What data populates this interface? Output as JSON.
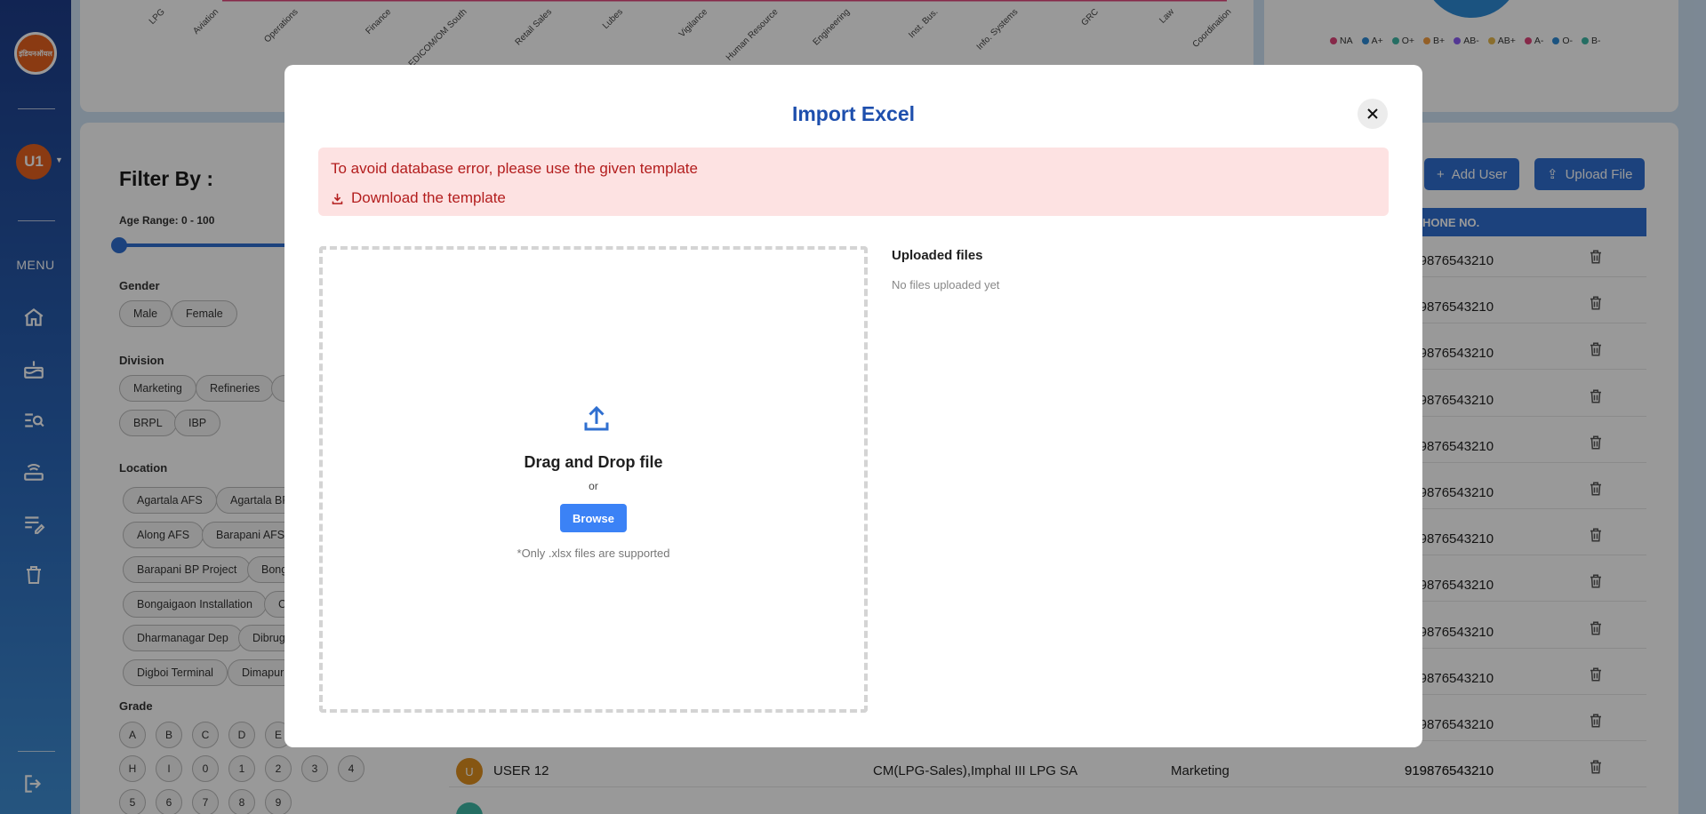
{
  "sidebar": {
    "logo_text": "इंडियनऑयल",
    "user_initials": "U1",
    "menu_label": "MENU",
    "icons": [
      "home-icon",
      "cake-icon",
      "search-list-icon",
      "router-icon",
      "edit-list-icon",
      "trash-icon"
    ],
    "logout_icon": "logout-icon"
  },
  "chart_bg": {
    "x_labels": [
      "LPG",
      "Aviation",
      "Operations",
      "Finance",
      "EDICOM/OM South",
      "Retail Sales",
      "Lubes",
      "Vigilance",
      "Human Resource",
      "Engineering",
      "Inst. Bus.",
      "Info. Systems",
      "GRC",
      "Law",
      "Coordination"
    ],
    "legend": [
      {
        "label": "NA",
        "color": "#e0457b"
      },
      {
        "label": "A+",
        "color": "#2e8ad6"
      },
      {
        "label": "O+",
        "color": "#3fb8a6"
      },
      {
        "label": "B+",
        "color": "#f59e42"
      },
      {
        "label": "AB-",
        "color": "#8b5cf6"
      },
      {
        "label": "AB+",
        "color": "#e7b84b"
      },
      {
        "label": "A-",
        "color": "#e0457b"
      },
      {
        "label": "O-",
        "color": "#2e8ad6"
      },
      {
        "label": "B-",
        "color": "#3fb8a6"
      }
    ]
  },
  "filter": {
    "title": "Filter By :",
    "age_label": "Age Range: 0 - 100",
    "gender_label": "Gender",
    "gender": [
      "Male",
      "Female"
    ],
    "division_label": "Division",
    "division": [
      "Marketing",
      "Refineries",
      "BRPL",
      "IBP"
    ],
    "location_label": "Location",
    "location": [
      "Agartala AFS",
      "Agartala BP",
      "Along AFS",
      "Barapani AFS",
      "Barapani BP Project",
      "Bong",
      "Bongaigaon Installation",
      "C",
      "Dharmanagar Dep",
      "Dibrug",
      "Digboi Terminal",
      "Dimapur"
    ],
    "grade_label": "Grade",
    "grades": [
      "A",
      "B",
      "C",
      "D",
      "E",
      "H",
      "I",
      "0",
      "1",
      "2",
      "3",
      "4",
      "5",
      "6",
      "7",
      "8",
      "9"
    ]
  },
  "actions": {
    "add_user": "Add User",
    "upload_file": "Upload File"
  },
  "table": {
    "phone_header": "HONE NO.",
    "phones": [
      "919876543210",
      "919876543210",
      "919876543210",
      "919876543210",
      "919876543210",
      "919876543210",
      "919876543210",
      "919876543210",
      "919876543210",
      "919876543210",
      "919876543210",
      "919876543210"
    ],
    "visible_row": {
      "initial": "U",
      "name": "USER 12",
      "role": "CM(LPG-Sales),Imphal III LPG SA",
      "division": "Marketing",
      "phone": "919876543210"
    }
  },
  "modal": {
    "title": "Import Excel",
    "alert_message": "To avoid database error, please use the given template",
    "download_link": "Download the template",
    "dropzone_title": "Drag and Drop file",
    "or_text": "or",
    "browse_label": "Browse",
    "note": "*Only .xlsx files are supported",
    "uploaded_title": "Uploaded files",
    "uploaded_empty": "No files uploaded yet"
  }
}
